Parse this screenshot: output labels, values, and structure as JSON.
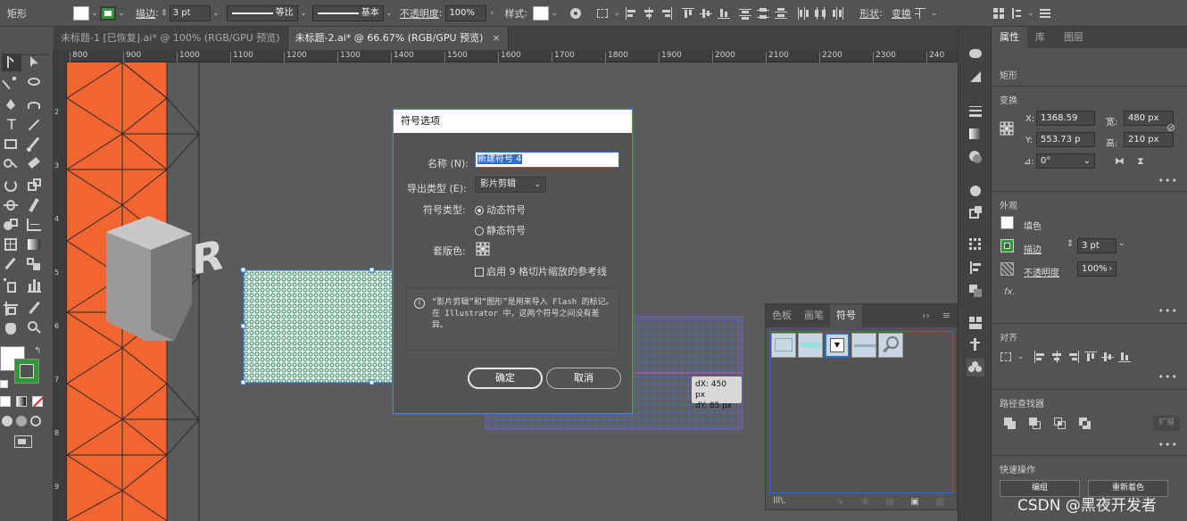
{
  "control_bar": {
    "tool_name": "矩形",
    "stroke_label": "描边",
    "stroke_value": "3 pt",
    "profile_label": "等比",
    "brush_label": "基本",
    "opacity_label": "不透明度",
    "opacity_value": "100%",
    "style_label": "样式",
    "shape_label": "形状",
    "transform_label": "变换"
  },
  "doc_tabs": [
    {
      "label": "未标题-1 [已恢复].ai* @ 100% (RGB/GPU 预览)"
    },
    {
      "label": "未标题-2.ai* @ 66.67% (RGB/GPU 预览)",
      "close": "×"
    }
  ],
  "ruler": {
    "h_ticks": [
      "800",
      "900",
      "1000",
      "1100",
      "1200",
      "1300",
      "1400",
      "1500",
      "1600",
      "1700",
      "1800",
      "1900",
      "2000",
      "2100",
      "2200",
      "2300",
      "240"
    ],
    "v_ticks": [
      "2",
      "3",
      "4",
      "5",
      "6",
      "7",
      "8",
      "9"
    ]
  },
  "dialog": {
    "title": "符号选项",
    "name_label": "名称 (N):",
    "name_value": "新建符号 4",
    "export_label": "导出类型 (E):",
    "export_value": "影片剪辑",
    "symbol_type_label": "符号类型:",
    "dynamic_label": "动态符号",
    "static_label": "静态符号",
    "registration_label": "套版色:",
    "nine_slice_label": "启用 9 格切片缩放的参考线",
    "info_text": "“影片剪辑”和“图形”是用来导入 Flash 的标记。在 Illustrator 中，这两个符号之间没有差异。",
    "ok_label": "确定",
    "cancel_label": "取消"
  },
  "tooltip": {
    "dx": "dX: 450 px",
    "dy": "dY: 85 px"
  },
  "symbols_panel": {
    "tabs": [
      "色板",
      "画笔",
      "符号"
    ],
    "active_tab": "符号",
    "collapse": "››",
    "library_icon": "symbol-library-icon"
  },
  "properties": {
    "tabs": [
      "属性",
      "库",
      "图层"
    ],
    "active_tab": "属性",
    "object_type": "矩形",
    "transform_header": "变换",
    "x_label": "X:",
    "x_value": "1368.59",
    "y_label": "Y:",
    "y_value": "553.73 p",
    "w_label": "宽:",
    "w_value": "480 px",
    "h_label": "高:",
    "h_value": "210 px",
    "angle_label": "⊿:",
    "angle_value": "0°",
    "appearance_header": "外观",
    "fill_label": "填色",
    "stroke_label": "描边",
    "stroke_value": "3 pt",
    "opacity_label": "不透明度",
    "opacity_value": "100%",
    "fx_label": "fx.",
    "align_header": "对齐",
    "pathfinder_header": "路径查找器",
    "expand_label": "扩展",
    "quick_actions_header": "快速操作",
    "group_label": "编组",
    "recolor_label": "重新着色",
    "more": "•••"
  },
  "watermark": "CSDN @黑夜开发者",
  "colors": {
    "orange": "#f26430",
    "selection_blue": "#2a6fd0",
    "guide_magenta": "#d44fd4"
  }
}
